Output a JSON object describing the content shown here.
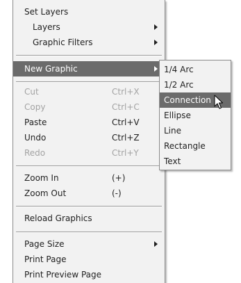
{
  "main_menu": {
    "set_layers": "Set Layers",
    "layers": "Layers",
    "graphic_filters": "Graphic Filters",
    "new_graphic": "New Graphic",
    "cut": {
      "label": "Cut",
      "shortcut": "Ctrl+X"
    },
    "copy": {
      "label": "Copy",
      "shortcut": "Ctrl+C"
    },
    "paste": {
      "label": "Paste",
      "shortcut": "Ctrl+V"
    },
    "undo": {
      "label": "Undo",
      "shortcut": "Ctrl+Z"
    },
    "redo": {
      "label": "Redo",
      "shortcut": "Ctrl+Y"
    },
    "zoom_in": {
      "label": "Zoom In",
      "shortcut": "(+)"
    },
    "zoom_out": {
      "label": "Zoom Out",
      "shortcut": "(-)"
    },
    "reload_graphics": "Reload Graphics",
    "page_size": "Page Size",
    "print_page": "Print Page",
    "print_preview_page": "Print Preview Page"
  },
  "sub_menu": {
    "items": [
      "1/4 Arc",
      "1/2 Arc",
      "Connection",
      "Ellipse",
      "Line",
      "Rectangle",
      "Text"
    ]
  }
}
